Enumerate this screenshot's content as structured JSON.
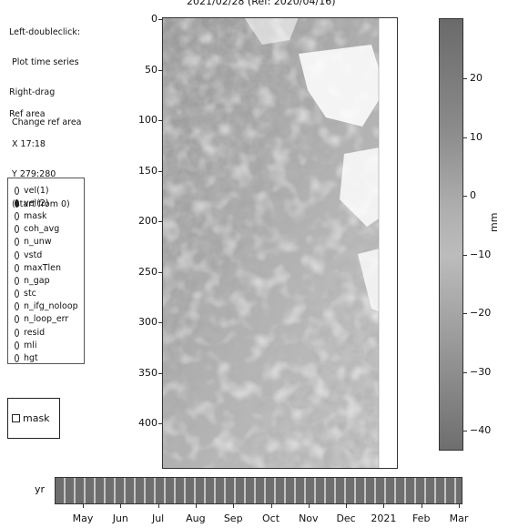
{
  "instructions": {
    "line1": "Left-doubleclick:",
    "line2": " Plot time series",
    "line3": "Right-drag",
    "line4": " Change ref area"
  },
  "ref_area": {
    "title": "Ref area",
    "x": " X 17:18",
    "y": " Y 279:280",
    "note": " (start from 0)"
  },
  "map_title": "2021/02/28 (Ref: 2020/04/16)",
  "radio_options": [
    "vel(1)",
    "vel(2)",
    "mask",
    "coh_avg",
    "n_unw",
    "vstd",
    "maxTlen",
    "n_gap",
    "stc",
    "n_ifg_noloop",
    "n_loop_err",
    "resid",
    "mli",
    "hgt"
  ],
  "radio_selected": "vel(2)",
  "mask_checkbox": {
    "label": "mask",
    "checked": false
  },
  "image_axis": {
    "y_ticks": [
      "0",
      "50",
      "100",
      "150",
      "200",
      "250",
      "300",
      "350",
      "400"
    ]
  },
  "colorbar": {
    "ticks": [
      "20",
      "10",
      "0",
      "−10",
      "−20",
      "−30",
      "−40"
    ],
    "unit": "mm"
  },
  "time_slider": {
    "label": "yr",
    "months": [
      "May",
      "Jun",
      "Jul",
      "Aug",
      "Sep",
      "Oct",
      "Nov",
      "Dec",
      "2021",
      "Feb",
      "Mar"
    ]
  }
}
